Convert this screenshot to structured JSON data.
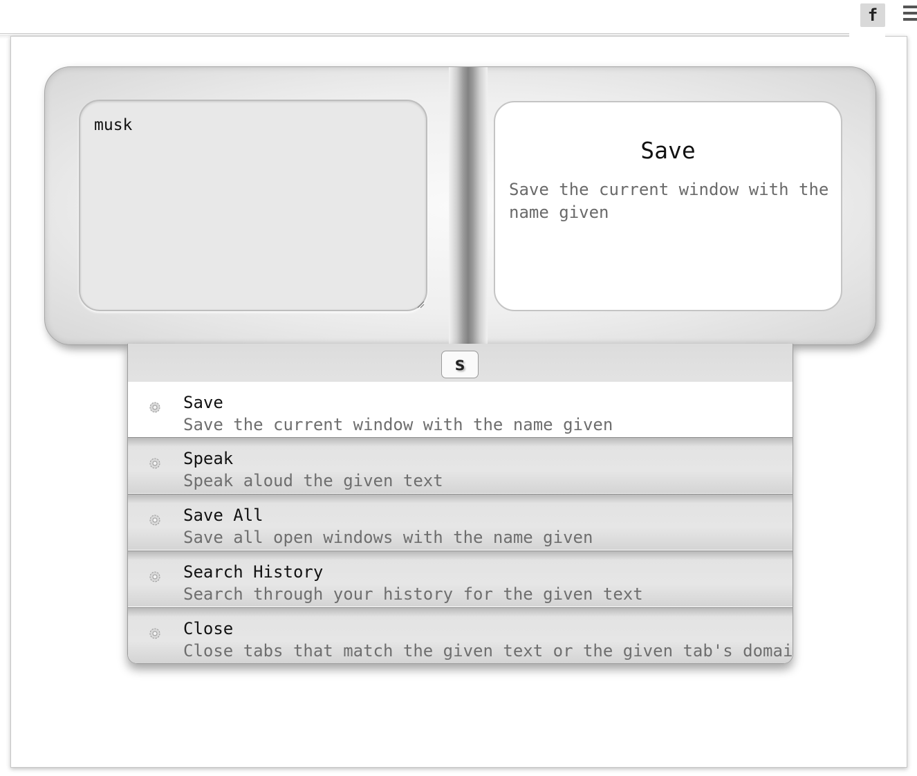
{
  "toolbar": {
    "extension_label": "f",
    "extension_icon": "extension-f-icon",
    "menu_icon": "hamburger-menu-icon"
  },
  "input": {
    "value": "musk"
  },
  "detail": {
    "title": "Save",
    "description": "Save the current window with the name given"
  },
  "results": {
    "query": "s",
    "items": [
      {
        "title": "Save",
        "description": "Save the current window with the name given",
        "icon": "gear-icon",
        "selected": true
      },
      {
        "title": "Speak",
        "description": "Speak aloud the given text",
        "icon": "gear-icon",
        "selected": false
      },
      {
        "title": "Save All",
        "description": "Save all open windows with the name given",
        "icon": "gear-icon",
        "selected": false
      },
      {
        "title": "Search History",
        "description": "Search through your history for the given text",
        "icon": "gear-icon",
        "selected": false
      },
      {
        "title": "Close",
        "description": "Close tabs that match the given text or the given tab's domain",
        "icon": "gear-icon",
        "selected": false
      }
    ]
  }
}
